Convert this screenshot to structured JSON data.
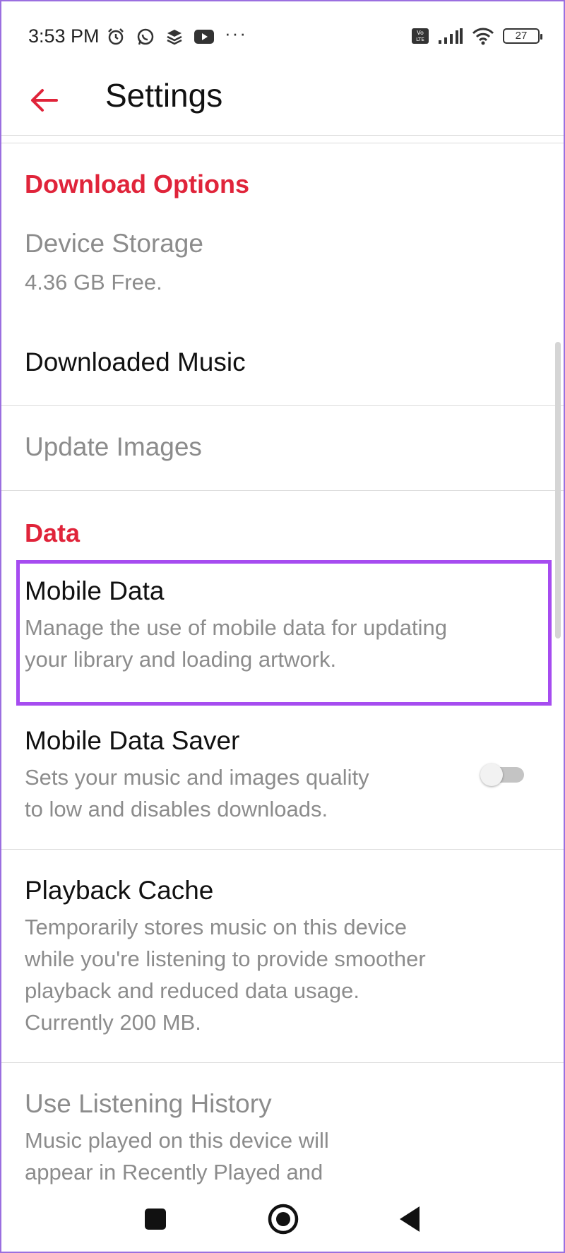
{
  "status_bar": {
    "time": "3:53 PM",
    "battery": "27",
    "left_icons": [
      "alarm-icon",
      "whatsapp-icon",
      "layers-icon",
      "youtube-icon"
    ],
    "right_icons": [
      "volte-icon",
      "signal-icon",
      "wifi-icon",
      "battery-icon"
    ]
  },
  "app_bar": {
    "title": "Settings",
    "back_icon": "back-arrow-icon"
  },
  "colors": {
    "accent": "#e0243a",
    "highlight": "#a64cf0",
    "secondary_text": "#8c8c8c"
  },
  "sections": {
    "download_options": {
      "header": "Download Options",
      "device_storage": {
        "title": "Device Storage",
        "subtitle": "4.36 GB Free."
      },
      "downloaded_music": {
        "title": "Downloaded Music"
      },
      "update_images": {
        "title": "Update Images"
      }
    },
    "data": {
      "header": "Data",
      "mobile_data": {
        "title": "Mobile Data",
        "subtitle_line1": "Manage the use of mobile data for updating",
        "subtitle_line2": "your library and loading artwork."
      },
      "mobile_data_saver": {
        "title": "Mobile Data Saver",
        "subtitle_line1": "Sets your music and images quality",
        "subtitle_line2": "to low and disables downloads.",
        "enabled": false
      },
      "playback_cache": {
        "title": "Playback Cache",
        "subtitle_line1": "Temporarily stores music on this device",
        "subtitle_line2": "while you're listening to provide smoother",
        "subtitle_line3": "playback and reduced data usage.",
        "subtitle_line4": "Currently 200 MB."
      },
      "listening_history": {
        "title": "Use Listening History",
        "subtitle_line1": "Music played on this device will",
        "subtitle_line2": "appear in Recently Played and"
      }
    }
  },
  "nav_bar": {
    "icons": [
      "recents-square-icon",
      "home-circle-icon",
      "back-triangle-icon"
    ]
  }
}
